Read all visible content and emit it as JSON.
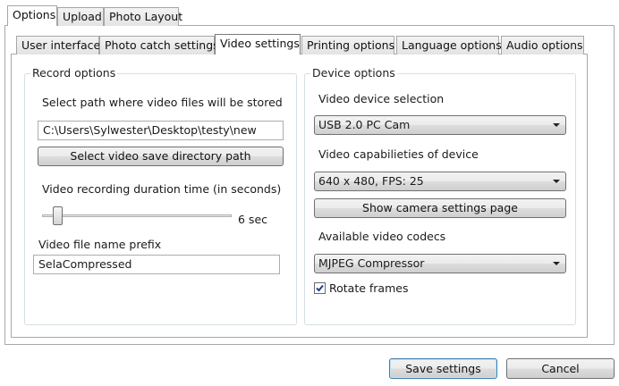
{
  "top_tabs": [
    "Options",
    "Upload",
    "Photo Layout"
  ],
  "sub_tabs": [
    "User interface",
    "Photo catch settings",
    "Video settings",
    "Printing options",
    "Language options",
    "Audio options"
  ],
  "record": {
    "title": "Record options",
    "path_label": "Select path where video files will be stored",
    "path_value": "C:\\Users\\Sylwester\\Desktop\\testy\\new",
    "select_dir_button": "Select video save directory path",
    "duration_label": "Video recording duration time (in seconds)",
    "duration_value": "6 sec",
    "prefix_label": "Video file name prefix",
    "prefix_value": "SelaCompressed"
  },
  "device": {
    "title": "Device options",
    "device_label": "Video device selection",
    "device_value": "USB 2.0 PC Cam",
    "capabilities_label": "Video capabilieties of device",
    "capabilities_value": "640 x 480, FPS: 25",
    "camera_settings_button": "Show camera settings page",
    "codecs_label": "Available video codecs",
    "codec_value": "MJPEG Compressor",
    "rotate_label": "Rotate frames",
    "rotate_checked": true
  },
  "footer": {
    "save_label": "Save settings",
    "cancel_label": "Cancel"
  }
}
